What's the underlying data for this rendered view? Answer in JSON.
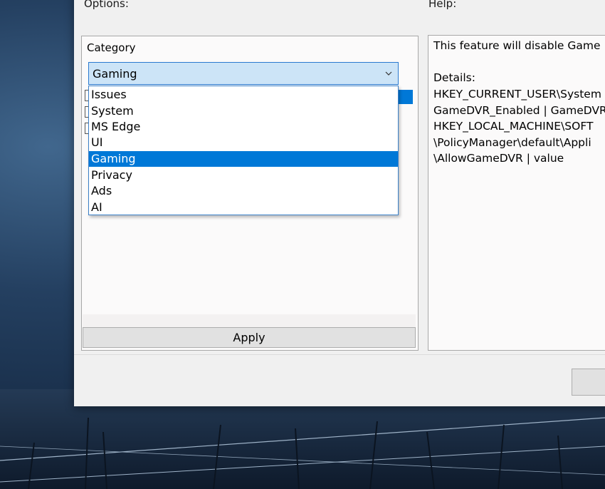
{
  "sections": {
    "options_title": "Options:",
    "help_title": "Help:"
  },
  "category": {
    "label": "Category",
    "selected": "Gaming",
    "options": [
      "Issues",
      "System",
      "MS Edge",
      "UI",
      "Gaming",
      "Privacy",
      "Ads",
      "AI"
    ]
  },
  "apply_button": "Apply",
  "help": {
    "lines": [
      "This feature will disable Game",
      "",
      "Details:",
      "HKEY_CURRENT_USER\\System",
      "GameDVR_Enabled | GameDVR",
      "HKEY_LOCAL_MACHINE\\SOFT",
      "\\PolicyManager\\default\\Appli",
      "\\AllowGameDVR | value"
    ]
  },
  "colors": {
    "selection": "#0078d7",
    "combo_background": "#cce4f7",
    "combo_border": "#2a7ad0"
  }
}
